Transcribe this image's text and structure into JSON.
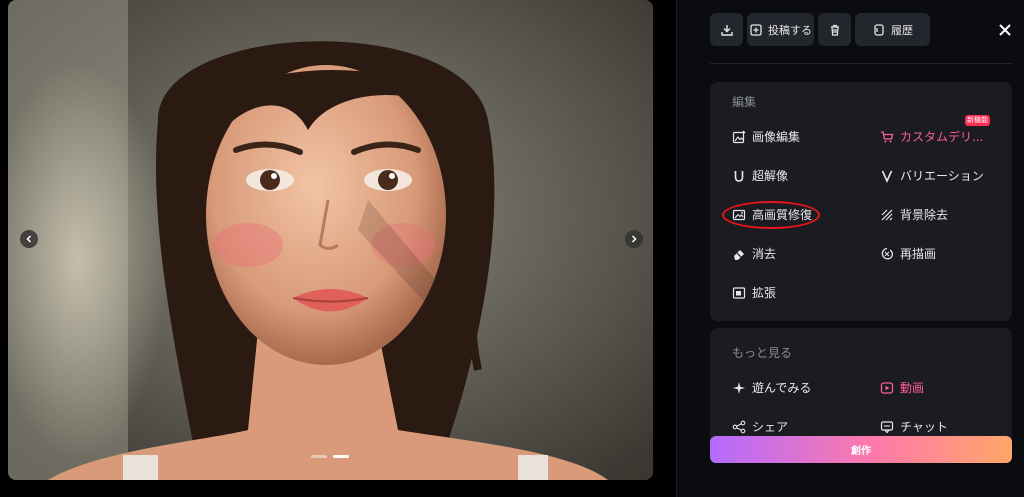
{
  "viewer": {
    "prev_icon": "chevron-left-icon",
    "next_icon": "chevron-right-icon",
    "slides": 2,
    "active_slide": 2
  },
  "toolbar": {
    "download_icon": "download-icon",
    "post_label": "投稿する",
    "post_icon": "plus-square-icon",
    "delete_icon": "trash-icon",
    "history_label": "履歴",
    "history_icon": "history-icon",
    "close_icon": "close-icon"
  },
  "edit": {
    "title": "編集",
    "new_badge": "新機能",
    "items": [
      {
        "label": "画像編集",
        "icon": "image-edit-icon"
      },
      {
        "label": "カスタムデリ...",
        "icon": "cart-icon"
      },
      {
        "label": "超解像",
        "icon": "upscale-icon"
      },
      {
        "label": "バリエーション",
        "icon": "variation-icon"
      },
      {
        "label": "高画質修復",
        "icon": "image-restore-icon"
      },
      {
        "label": "背景除去",
        "icon": "background-remove-icon"
      },
      {
        "label": "消去",
        "icon": "eraser-icon"
      },
      {
        "label": "再描画",
        "icon": "redraw-icon"
      },
      {
        "label": "拡張",
        "icon": "expand-icon"
      }
    ]
  },
  "more": {
    "title": "もっと見る",
    "items": [
      {
        "label": "遊んでみる",
        "icon": "sparkle-icon"
      },
      {
        "label": "動画",
        "icon": "video-icon"
      },
      {
        "label": "シェア",
        "icon": "share-icon"
      },
      {
        "label": "チャット",
        "icon": "chat-icon"
      }
    ]
  },
  "create_label": "創作",
  "colors": {
    "accent_pink": "#ff5d92",
    "badge_red": "#ff2d55",
    "highlight_red": "#e8141c",
    "gradient": [
      "#b36bff",
      "#ff7aa8",
      "#ffa66a"
    ]
  }
}
